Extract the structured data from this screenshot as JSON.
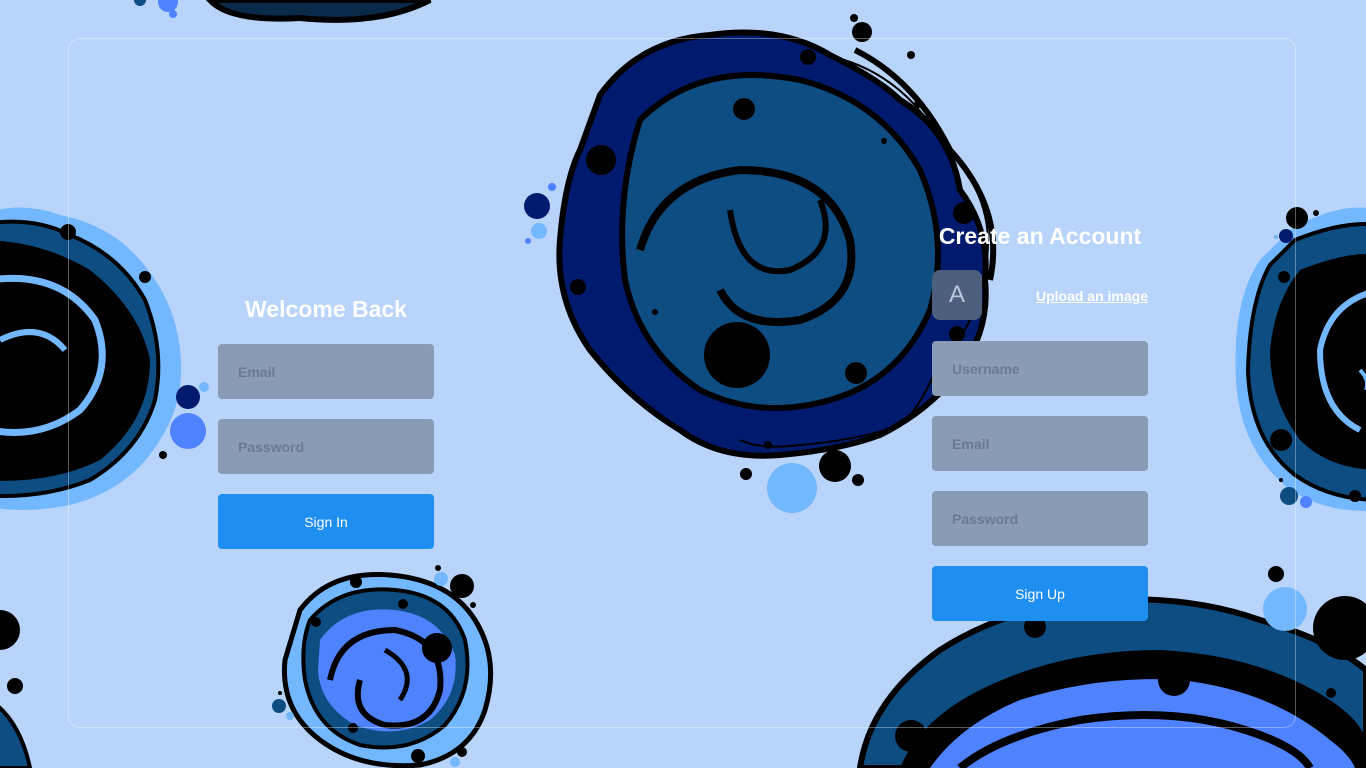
{
  "signin": {
    "title": "Welcome Back",
    "email_placeholder": "Email",
    "password_placeholder": "Password",
    "submit_label": "Sign In"
  },
  "signup": {
    "title": "Create an Account",
    "avatar_letter": "A",
    "upload_label": "Upload an image",
    "username_placeholder": "Username",
    "email_placeholder": "Email",
    "password_placeholder": "Password",
    "submit_label": "Sign Up"
  },
  "colors": {
    "background": "#b8d4fb",
    "field": "#8a9bb6",
    "button": "#1e8ef0",
    "text": "#ffffff",
    "blob_dark": "#0d4d82",
    "blob_navy": "#001a6e",
    "blob_light": "#73b8ff",
    "blob_mid": "#4f82ff"
  }
}
